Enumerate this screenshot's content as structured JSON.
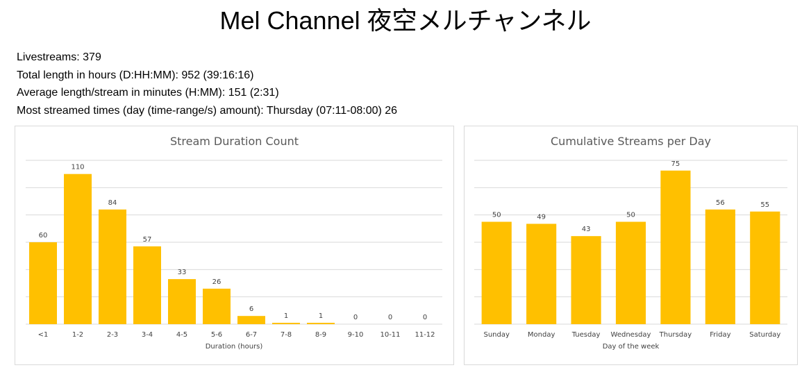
{
  "page": {
    "title": "Mel Channel 夜空メルチャンネル"
  },
  "stats": {
    "livestreams": "Livestreams: 379",
    "total_length": "Total length in hours (D:HH:MM): 952 (39:16:16)",
    "average_length": "Average length/stream in minutes (H:MM): 151 (2:31)",
    "most_streamed": "Most streamed times (day (time-range/s) amount): Thursday (07:11-08:00) 26"
  },
  "colors": {
    "bar": "#FFC000",
    "grid": "#d9d9d9",
    "text": "#595959"
  },
  "chart_data": [
    {
      "type": "bar",
      "title": "Stream Duration Count",
      "xlabel": "Duration (hours)",
      "ylabel": "",
      "categories": [
        "<1",
        "1-2",
        "2-3",
        "3-4",
        "4-5",
        "5-6",
        "6-7",
        "7-8",
        "8-9",
        "9-10",
        "10-11",
        "11-12"
      ],
      "values": [
        60,
        110,
        84,
        57,
        33,
        26,
        6,
        1,
        1,
        0,
        0,
        0
      ],
      "ylim": [
        0,
        120
      ],
      "grid": true,
      "legend": "none"
    },
    {
      "type": "bar",
      "title": "Cumulative Streams per Day",
      "xlabel": "Day of the week",
      "ylabel": "",
      "categories": [
        "Sunday",
        "Monday",
        "Tuesday",
        "Wednesday",
        "Thursday",
        "Friday",
        "Saturday"
      ],
      "values": [
        50,
        49,
        43,
        50,
        75,
        56,
        55
      ],
      "ylim": [
        0,
        80
      ],
      "grid": true,
      "legend": "none"
    }
  ]
}
